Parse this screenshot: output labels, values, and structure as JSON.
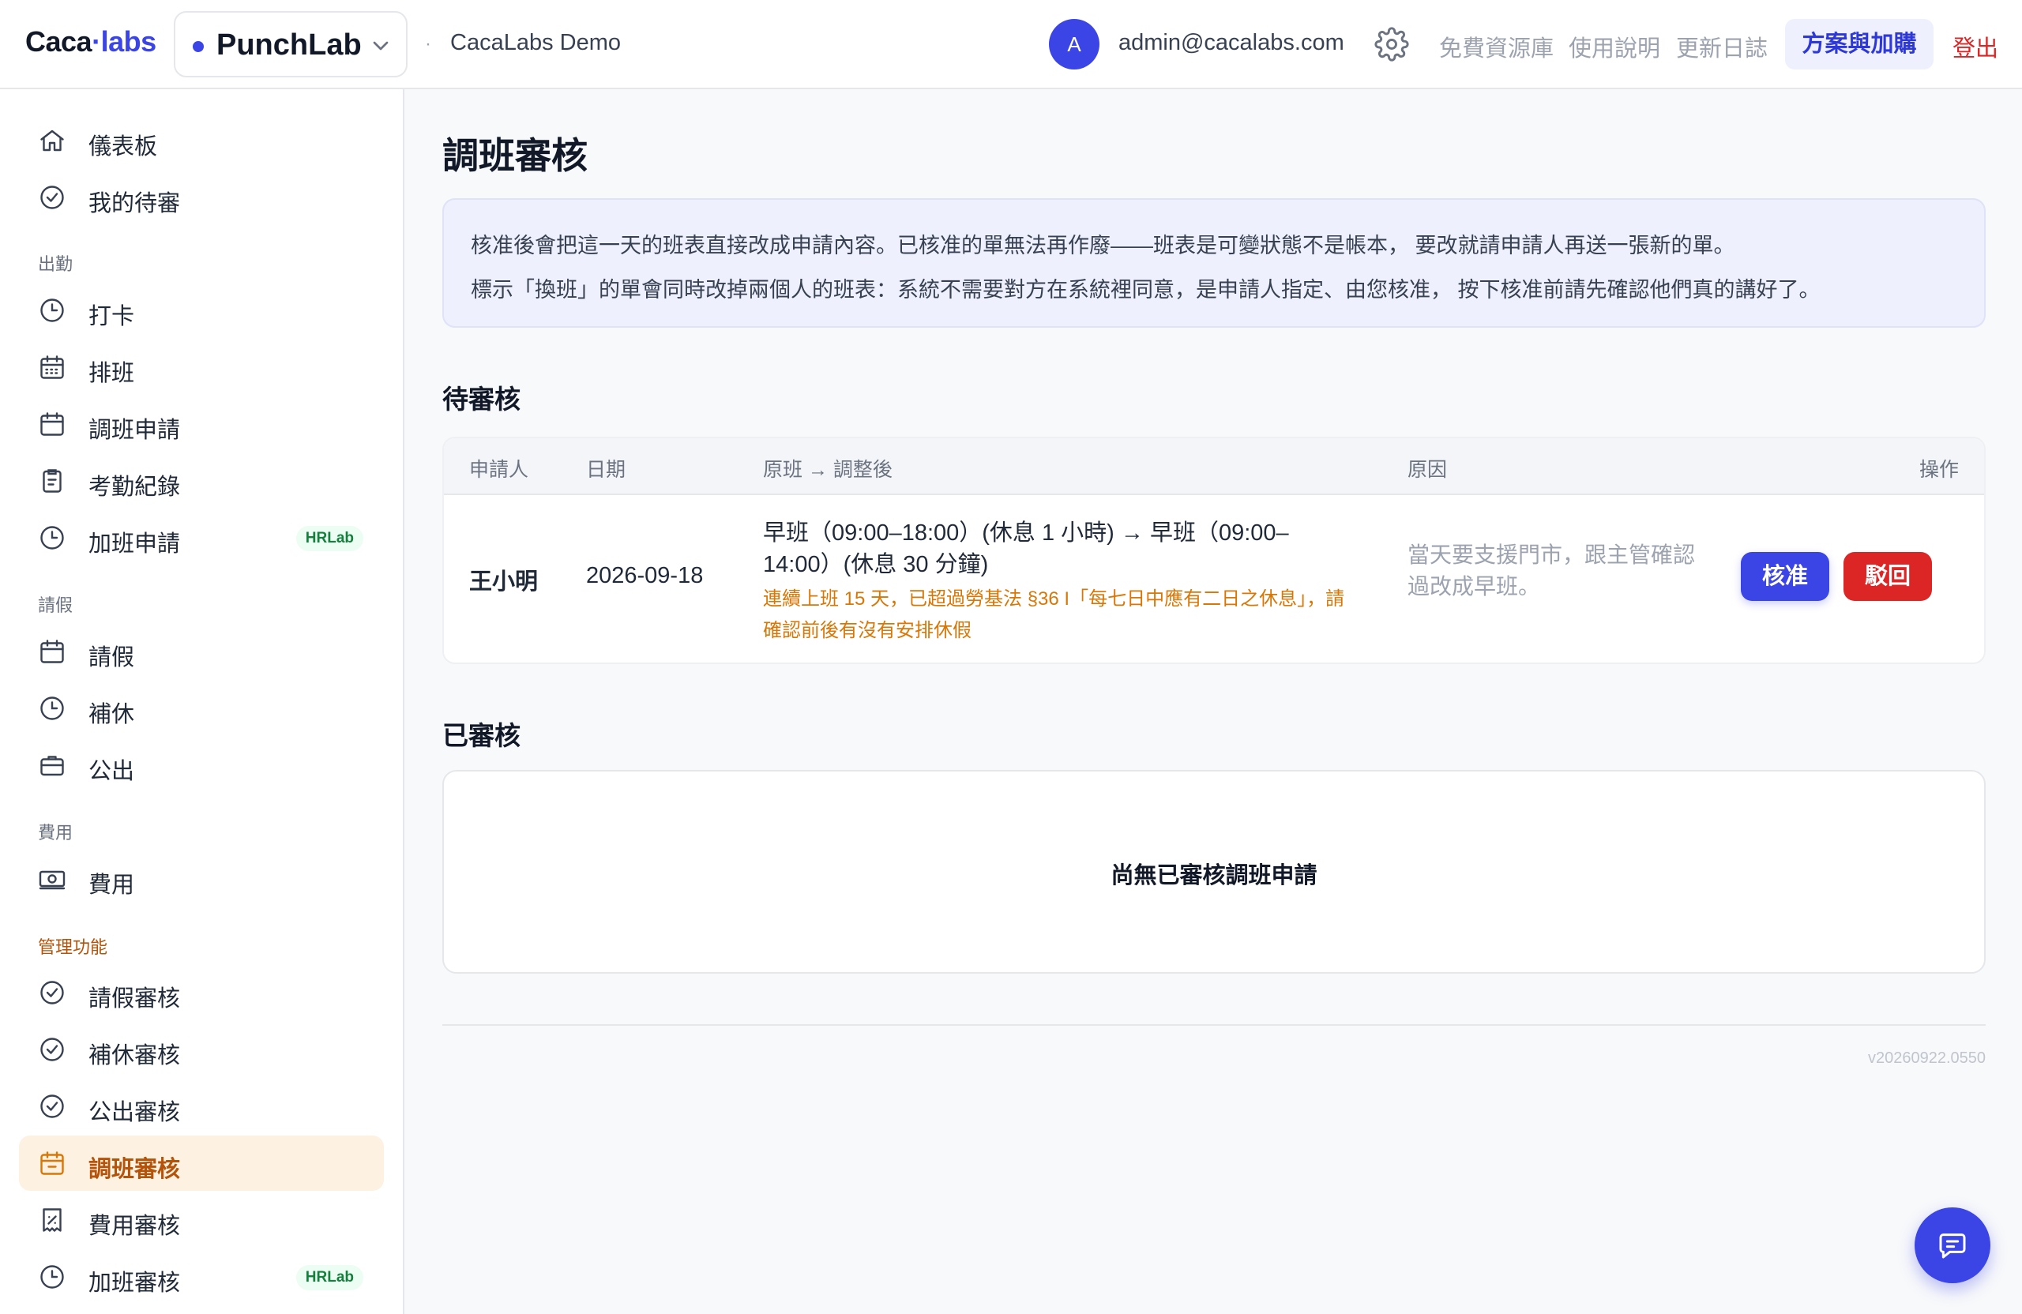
{
  "header": {
    "logo_left": "Caca",
    "logo_dot": "·",
    "logo_right": "labs",
    "app_name": "PunchLab",
    "org_separator": "·",
    "org_name": "CacaLabs Demo",
    "avatar_initial": "A",
    "user_email": "admin@cacalabs.com",
    "links": [
      "免費資源庫",
      "使用說明",
      "更新日誌"
    ],
    "plan_button": "方案與加購",
    "logout": "登出"
  },
  "sidebar": {
    "top_items": [
      {
        "label": "儀表板",
        "icon": "home-icon"
      },
      {
        "label": "我的待審",
        "icon": "check-circle-icon"
      }
    ],
    "sections": [
      {
        "title": "出勤",
        "items": [
          {
            "label": "打卡",
            "icon": "clock-icon"
          },
          {
            "label": "排班",
            "icon": "calendar-grid-icon"
          },
          {
            "label": "調班申請",
            "icon": "calendar-icon"
          },
          {
            "label": "考勤紀錄",
            "icon": "clipboard-icon"
          },
          {
            "label": "加班申請",
            "icon": "clock-icon",
            "badge": "HRLab"
          }
        ]
      },
      {
        "title": "請假",
        "items": [
          {
            "label": "請假",
            "icon": "calendar-icon"
          },
          {
            "label": "補休",
            "icon": "clock-icon"
          },
          {
            "label": "公出",
            "icon": "briefcase-icon"
          }
        ]
      },
      {
        "title": "費用",
        "items": [
          {
            "label": "費用",
            "icon": "cash-icon"
          }
        ]
      },
      {
        "title": "管理功能",
        "items": [
          {
            "label": "請假審核",
            "icon": "check-circle-icon"
          },
          {
            "label": "補休審核",
            "icon": "check-circle-icon"
          },
          {
            "label": "公出審核",
            "icon": "check-circle-icon"
          },
          {
            "label": "調班審核",
            "icon": "calendar-icon",
            "active": true
          },
          {
            "label": "費用審核",
            "icon": "receipt-icon"
          },
          {
            "label": "加班審核",
            "icon": "clock-icon",
            "badge": "HRLab"
          }
        ]
      }
    ]
  },
  "main": {
    "title": "調班審核",
    "notice_lines": [
      "核准後會把這一天的班表直接改成申請內容。已核准的單無法再作廢——班表是可變狀態不是帳本， 要改就請申請人再送一張新的單。",
      "標示「換班」的單會同時改掉兩個人的班表：系統不需要對方在系統裡同意，是申請人指定、由您核准， 按下核准前請先確認他們真的講好了。"
    ],
    "pending_title": "待審核",
    "table_headers": {
      "applicant": "申請人",
      "date": "日期",
      "change": "原班 → 調整後",
      "reason": "原因",
      "action": "操作"
    },
    "pending_rows": [
      {
        "applicant": "王小明",
        "date": "2026-09-18",
        "change_line1": "早班（09:00–18:00）(休息 1 小時) → 早班（09:00–",
        "change_line2": "14:00）(休息 30 分鐘)",
        "warning": "連續上班 15 天，已超過勞基法 §36 I「每七日中應有二日之休息」，請確認前後有沒有安排休假",
        "reason": "當天要支援門市，跟主管確認過改成早班。",
        "approve_label": "核准",
        "reject_label": "駁回"
      }
    ],
    "reviewed_title": "已審核",
    "reviewed_empty": "尚無已審核調班申請",
    "version": "v20260922.0550"
  },
  "colors": {
    "brand": "#3b45e6",
    "danger": "#dc2626",
    "warning": "#d97706",
    "active_bg": "#fdf1e1",
    "active_text": "#b45309"
  }
}
